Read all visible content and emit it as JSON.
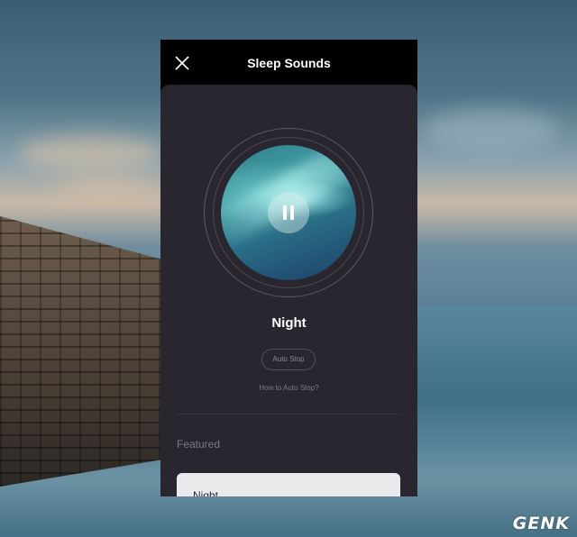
{
  "app": {
    "title": "Sleep Sounds",
    "close_icon": "close-icon"
  },
  "player": {
    "track_name": "Night",
    "state": "playing",
    "control_icon": "pause-icon",
    "auto_stop_label": "Auto Stop",
    "help_link": "How to Auto Stop?"
  },
  "featured": {
    "heading": "Featured",
    "items": [
      {
        "title": "Night"
      }
    ]
  },
  "watermark": "GENK"
}
